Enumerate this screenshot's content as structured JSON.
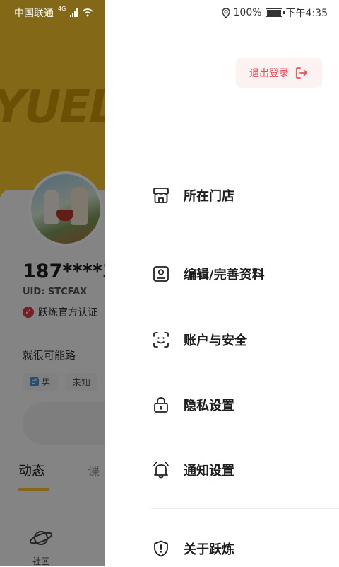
{
  "status_bar": {
    "carrier": "中国联通",
    "network": "4G",
    "battery_percent": "100%",
    "battery_level": 1.0,
    "time": "下午4:35"
  },
  "background_profile": {
    "logo_text": "YUEL!",
    "phone": "187****3",
    "uid": "UID: STCFAX",
    "certification": "跃炼官方认证",
    "signature": "就很可能路",
    "gender_tag": "男",
    "unknown_tag": "未知",
    "tabs": [
      {
        "label": "动态"
      },
      {
        "label": "课"
      }
    ],
    "community_label": "社区"
  },
  "drawer": {
    "logout_label": "退出登录",
    "menu": [
      {
        "label": "所在门店",
        "icon": "store-icon"
      },
      {
        "label": "编辑/完善资料",
        "icon": "profile-card-icon"
      },
      {
        "label": "账户与安全",
        "icon": "face-scan-icon"
      },
      {
        "label": "隐私设置",
        "icon": "lock-icon"
      },
      {
        "label": "通知设置",
        "icon": "bell-icon"
      },
      {
        "label": "关于跃炼",
        "icon": "shield-alert-icon"
      }
    ]
  },
  "colors": {
    "accent_yellow": "#f6c52d",
    "logout_red": "#e8505b"
  }
}
